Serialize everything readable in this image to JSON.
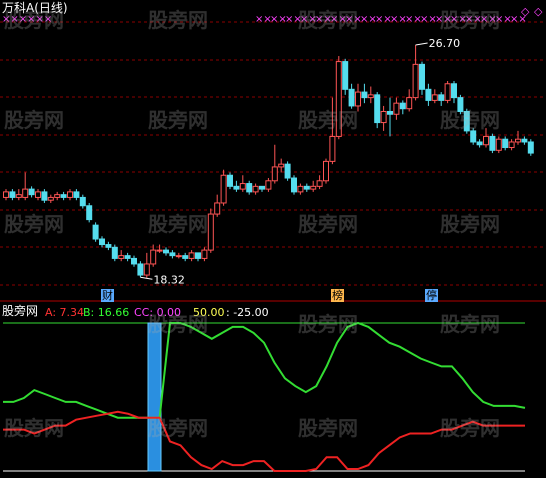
{
  "header": {
    "title": "万科A(日线)"
  },
  "indicator": {
    "name": "股旁网",
    "a_label": "A: 7.34",
    "b_label": "B: 16.66",
    "cc_label": "CC: 0.00",
    "fifty_label": "50.00",
    "neg_label": ": -25.00"
  },
  "annotations": {
    "high_price": "26.70",
    "low_price": "18.32"
  },
  "badges": [
    {
      "text": "财",
      "color": "#5aaaff"
    },
    {
      "text": "榜",
      "color": "#ffb84d"
    },
    {
      "text": "停",
      "color": "#5aaaff"
    }
  ],
  "watermark": "股旁网",
  "colors": {
    "up": "#ff5555",
    "down": "#55ddee",
    "grid": "#8b0000",
    "line_green": "#33dd33",
    "line_red": "#ee2222",
    "marker": "#ff44ff",
    "bar_blue": "#2a8fe0"
  },
  "chart_data": {
    "type": "candlestick",
    "y_range": [
      17.5,
      27.6
    ],
    "high": 26.7,
    "low": 18.32,
    "candles": [
      [
        21.2,
        21.4,
        21.1,
        21.5
      ],
      [
        21.4,
        21.2,
        21.1,
        21.5
      ],
      [
        21.2,
        21.3,
        21.1,
        21.5
      ],
      [
        21.2,
        21.5,
        21.1,
        22.1
      ],
      [
        21.5,
        21.3,
        21.2,
        21.6
      ],
      [
        21.2,
        21.4,
        21.1,
        21.5
      ],
      [
        21.4,
        21.1,
        21.0,
        21.5
      ],
      [
        21.1,
        21.2,
        21.0,
        21.3
      ],
      [
        21.2,
        21.3,
        21.1,
        21.4
      ],
      [
        21.3,
        21.2,
        21.1,
        21.4
      ],
      [
        21.2,
        21.4,
        21.1,
        21.5
      ],
      [
        21.4,
        21.2,
        21.1,
        21.5
      ],
      [
        21.2,
        20.9,
        20.8,
        21.3
      ],
      [
        20.9,
        20.4,
        20.3,
        21.0
      ],
      [
        20.2,
        19.7,
        19.6,
        20.3
      ],
      [
        19.7,
        19.5,
        19.4,
        19.8
      ],
      [
        19.5,
        19.4,
        19.3,
        19.6
      ],
      [
        19.4,
        19.0,
        18.9,
        19.5
      ],
      [
        19.0,
        19.1,
        18.9,
        19.3
      ],
      [
        19.1,
        19.0,
        18.9,
        19.2
      ],
      [
        19.0,
        18.8,
        18.7,
        19.1
      ],
      [
        18.8,
        18.4,
        18.32,
        18.9
      ],
      [
        18.4,
        18.8,
        18.3,
        19.2
      ],
      [
        18.8,
        19.3,
        18.7,
        19.5
      ],
      [
        19.3,
        19.3,
        19.2,
        19.5
      ],
      [
        19.3,
        19.2,
        19.1,
        19.4
      ],
      [
        19.2,
        19.1,
        19.0,
        19.3
      ],
      [
        19.1,
        19.1,
        19.0,
        19.2
      ],
      [
        19.1,
        19.0,
        18.9,
        19.2
      ],
      [
        19.0,
        19.2,
        18.9,
        19.3
      ],
      [
        19.2,
        19.0,
        18.9,
        19.2
      ],
      [
        19.0,
        19.3,
        18.9,
        19.4
      ],
      [
        19.3,
        20.6,
        19.2,
        20.8
      ],
      [
        20.6,
        21.0,
        20.5,
        21.3
      ],
      [
        21.0,
        22.0,
        20.9,
        22.2
      ],
      [
        22.0,
        21.6,
        21.5,
        22.1
      ],
      [
        21.6,
        21.5,
        21.4,
        21.8
      ],
      [
        21.5,
        21.7,
        21.4,
        22.0
      ],
      [
        21.7,
        21.4,
        21.3,
        21.8
      ],
      [
        21.4,
        21.6,
        21.3,
        21.7
      ],
      [
        21.6,
        21.5,
        21.4,
        21.6
      ],
      [
        21.5,
        21.8,
        21.4,
        21.9
      ],
      [
        21.8,
        22.3,
        21.7,
        23.1
      ],
      [
        22.3,
        22.4,
        22.1,
        22.6
      ],
      [
        22.4,
        21.9,
        21.8,
        22.5
      ],
      [
        21.9,
        21.4,
        21.3,
        22.0
      ],
      [
        21.4,
        21.6,
        21.3,
        21.7
      ],
      [
        21.6,
        21.5,
        21.4,
        21.7
      ],
      [
        21.5,
        21.6,
        21.4,
        21.8
      ],
      [
        21.6,
        21.8,
        21.5,
        22.0
      ],
      [
        21.8,
        22.5,
        21.7,
        22.6
      ],
      [
        22.5,
        23.4,
        22.4,
        24.8
      ],
      [
        23.4,
        26.1,
        23.3,
        26.3
      ],
      [
        26.1,
        25.1,
        24.9,
        26.2
      ],
      [
        25.1,
        24.5,
        24.4,
        25.3
      ],
      [
        24.5,
        25.0,
        24.3,
        25.3
      ],
      [
        25.0,
        24.8,
        24.6,
        25.3
      ],
      [
        24.8,
        24.9,
        24.6,
        25.2
      ],
      [
        24.9,
        23.9,
        23.7,
        25.0
      ],
      [
        23.9,
        24.3,
        23.6,
        24.5
      ],
      [
        24.3,
        24.2,
        23.4,
        24.8
      ],
      [
        24.2,
        24.6,
        24.0,
        24.8
      ],
      [
        24.6,
        24.4,
        24.2,
        24.7
      ],
      [
        24.4,
        24.8,
        24.3,
        25.1
      ],
      [
        24.8,
        26.0,
        24.7,
        26.7
      ],
      [
        26.0,
        25.1,
        24.9,
        26.1
      ],
      [
        25.1,
        24.7,
        24.5,
        25.3
      ],
      [
        24.7,
        24.9,
        24.6,
        25.1
      ],
      [
        24.9,
        24.7,
        24.5,
        25.0
      ],
      [
        24.7,
        25.3,
        24.6,
        25.4
      ],
      [
        25.3,
        24.8,
        24.6,
        25.4
      ],
      [
        24.8,
        24.3,
        24.2,
        24.9
      ],
      [
        24.3,
        23.6,
        23.5,
        24.4
      ],
      [
        23.6,
        23.2,
        23.1,
        23.7
      ],
      [
        23.2,
        23.1,
        23.0,
        23.3
      ],
      [
        23.1,
        23.4,
        23.0,
        23.7
      ],
      [
        23.4,
        22.9,
        22.8,
        23.5
      ],
      [
        22.9,
        23.3,
        22.8,
        23.4
      ],
      [
        23.3,
        23.0,
        22.9,
        23.4
      ],
      [
        23.0,
        23.2,
        22.9,
        23.3
      ],
      [
        23.2,
        23.3,
        23.1,
        23.6
      ],
      [
        23.3,
        23.2,
        23.1,
        23.4
      ],
      [
        23.2,
        22.8,
        22.7,
        23.3
      ]
    ],
    "indicator_range": [
      -25,
      50
    ],
    "line_b": [
      10,
      10,
      12,
      16,
      14,
      12,
      10,
      10,
      8,
      6,
      4,
      2,
      2,
      2,
      2,
      2,
      50,
      50,
      48,
      45,
      42,
      45,
      48,
      48,
      45,
      40,
      30,
      22,
      18,
      15,
      18,
      28,
      40,
      48,
      50,
      48,
      44,
      40,
      38,
      35,
      32,
      30,
      28,
      28,
      22,
      15,
      10,
      8,
      8,
      8,
      7
    ],
    "line_a": [
      -4,
      -4,
      -4,
      -6,
      -4,
      -2,
      -2,
      1,
      2,
      3,
      4,
      5,
      4,
      2,
      2,
      2,
      -10,
      -12,
      -18,
      -22,
      -24,
      -20,
      -22,
      -22,
      -20,
      -20,
      -25,
      -25,
      -25,
      -25,
      -24,
      -18,
      -18,
      -24,
      -24,
      -22,
      -16,
      -12,
      -8,
      -6,
      -6,
      -6,
      -4,
      -4,
      -2,
      0,
      -2,
      -2,
      -2,
      -2,
      -2
    ],
    "cross_count": 18
  }
}
